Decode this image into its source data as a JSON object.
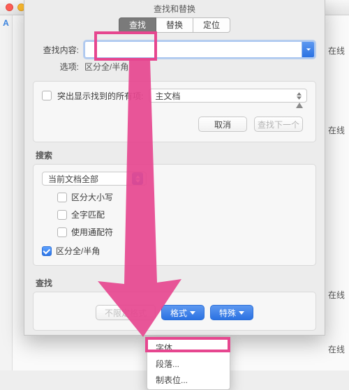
{
  "parent": {
    "tool_glyph": "A",
    "online_label": "在线"
  },
  "dialog": {
    "title": "查找和替换",
    "tabs": {
      "find": "查找",
      "replace": "替换",
      "goto": "定位"
    },
    "find_label": "查找内容:",
    "find_value": "",
    "options_label": "选项:",
    "options_value": "区分全/半角",
    "highlight_all_label": "突出显示找到的所有项:",
    "highlight_scope": "主文档",
    "cancel": "取消",
    "find_next": "查找下一个",
    "search_title": "搜索",
    "scope_value": "当前文档全部",
    "match_case": "区分大小写",
    "whole_word": "全字匹配",
    "wildcards": "使用通配符",
    "full_half": "区分全/半角",
    "find_title": "查找",
    "no_format": "不限定格式",
    "format_btn": "格式",
    "special_btn": "特殊",
    "menu": {
      "font": "字体...",
      "paragraph": "段落...",
      "tabs": "制表位..."
    }
  }
}
